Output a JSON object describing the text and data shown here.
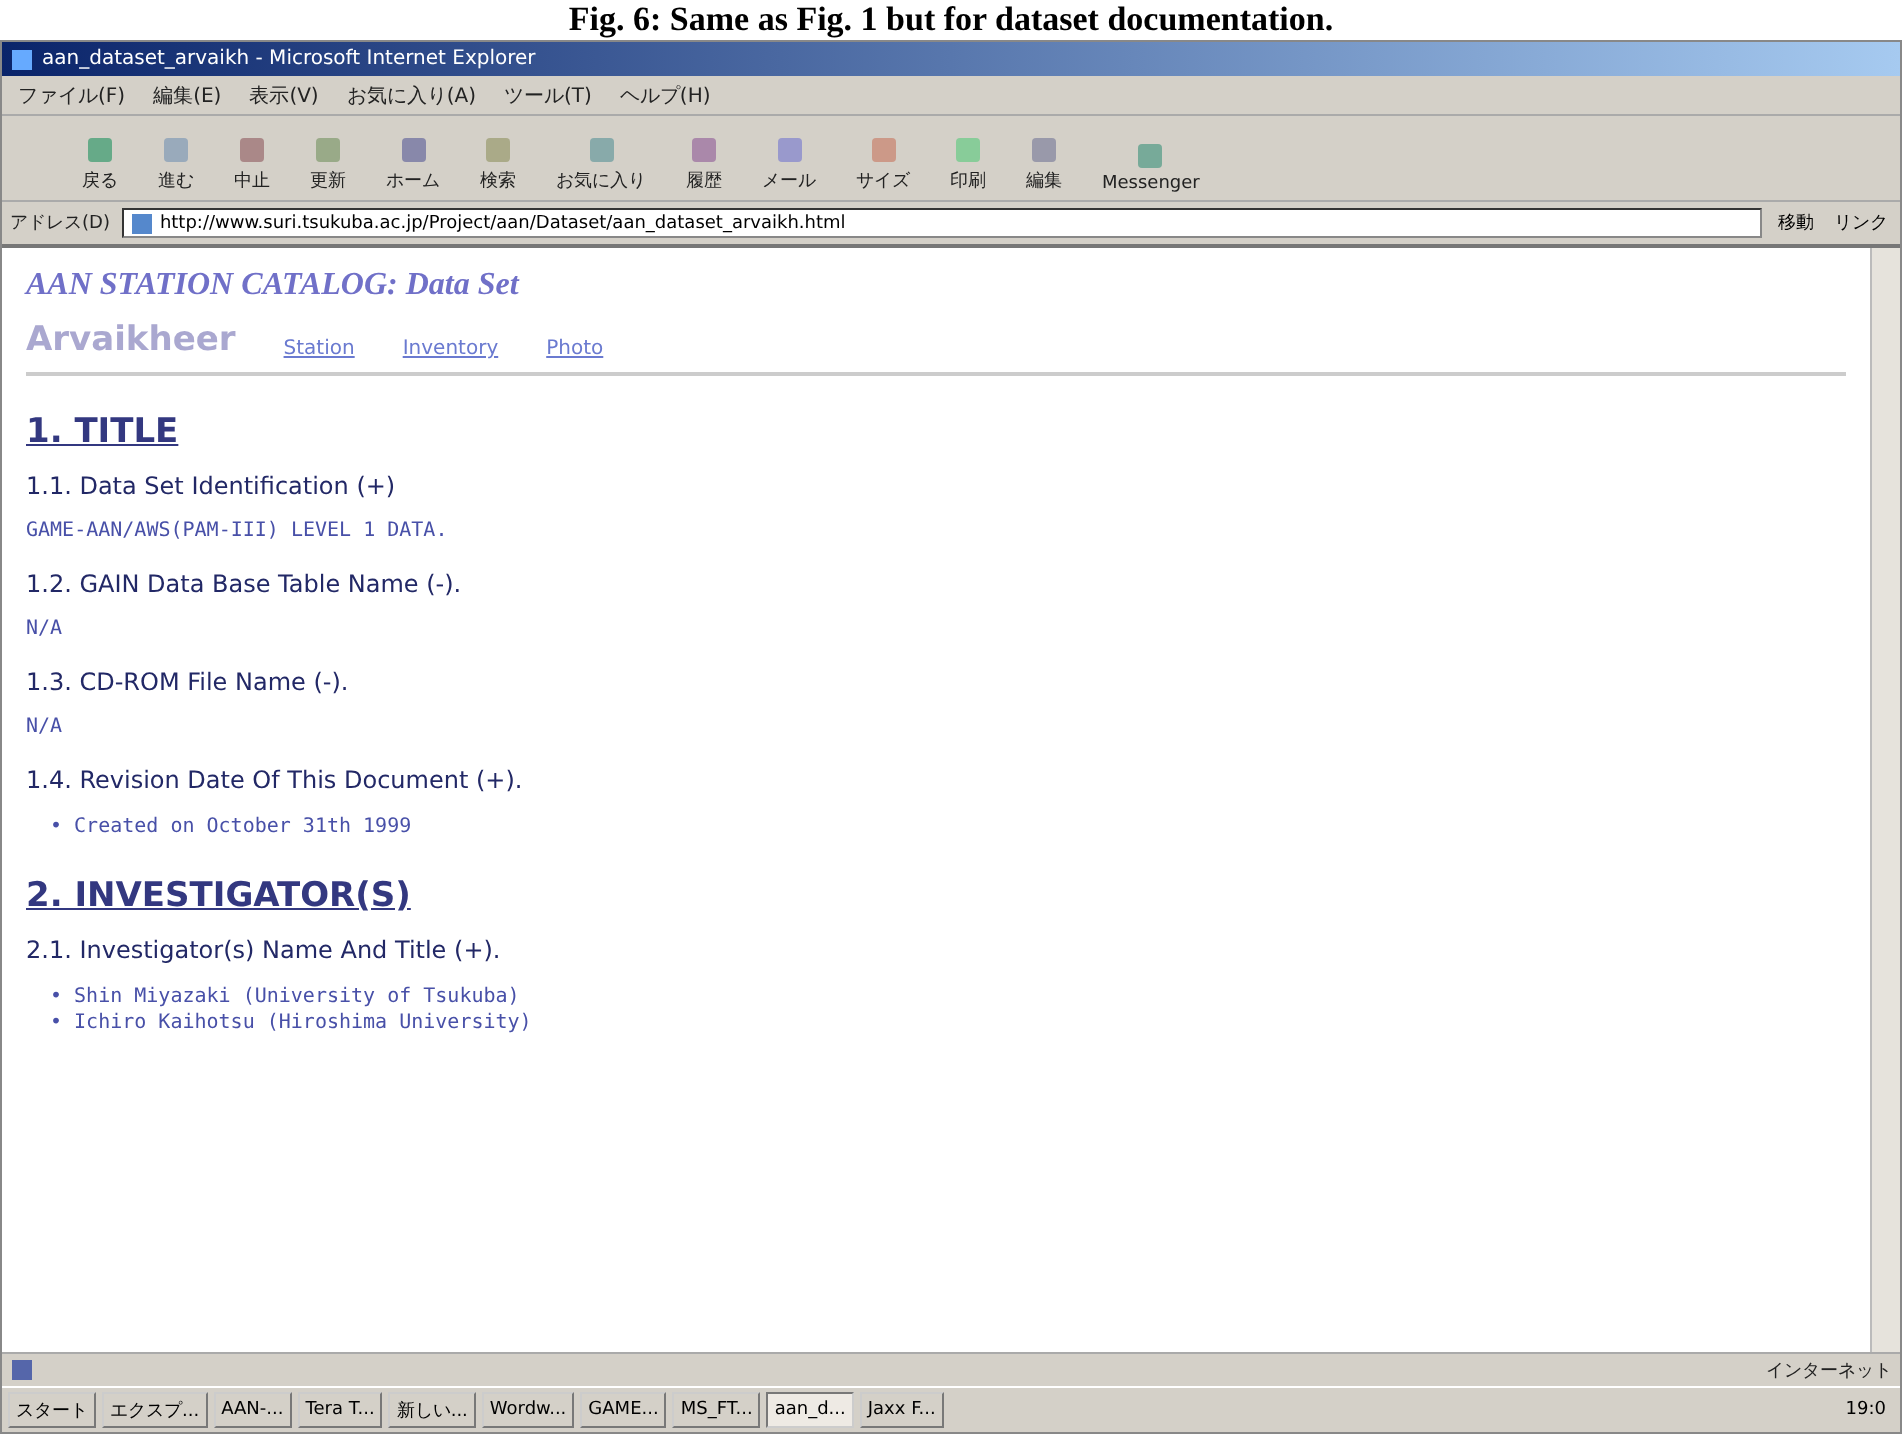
{
  "caption": "Fig. 6: Same as Fig. 1 but for dataset documentation.",
  "window": {
    "title": "aan_dataset_arvaikh - Microsoft Internet Explorer"
  },
  "menu": [
    "ファイル(F)",
    "編集(E)",
    "表示(V)",
    "お気に入り(A)",
    "ツール(T)",
    "ヘルプ(H)"
  ],
  "toolbar": [
    {
      "label": "戻る"
    },
    {
      "label": "進む"
    },
    {
      "label": "中止"
    },
    {
      "label": "更新"
    },
    {
      "label": "ホーム"
    },
    {
      "label": "検索"
    },
    {
      "label": "お気に入り"
    },
    {
      "label": "履歴"
    },
    {
      "label": "メール"
    },
    {
      "label": "サイズ"
    },
    {
      "label": "印刷"
    },
    {
      "label": "編集"
    },
    {
      "label": "Messenger"
    }
  ],
  "address": {
    "label": "アドレス(D)",
    "value": "http://www.suri.tsukuba.ac.jp/Project/aan/Dataset/aan_dataset_arvaikh.html",
    "go": "移動",
    "links": "リンク"
  },
  "page": {
    "heading": "AAN STATION CATALOG: Data Set",
    "station": "Arvaikheer",
    "nav": [
      "Station",
      "Inventory",
      "Photo"
    ],
    "sections": [
      {
        "title": "1. TITLE",
        "items": [
          {
            "title": "1.1. Data Set Identification (+)",
            "kind": "text",
            "lines": [
              "GAME-AAN/AWS(PAM-III) LEVEL 1 DATA."
            ]
          },
          {
            "title": "1.2. GAIN Data Base Table Name (-).",
            "kind": "text",
            "lines": [
              "N/A"
            ]
          },
          {
            "title": "1.3. CD-ROM File Name (-).",
            "kind": "text",
            "lines": [
              "N/A"
            ]
          },
          {
            "title": "1.4. Revision Date Of This Document (+).",
            "kind": "list",
            "marker": "•",
            "lines": [
              "Created on October 31th 1999"
            ]
          }
        ]
      },
      {
        "title": "2. INVESTIGATOR(S)",
        "items": [
          {
            "title": "2.1. Investigator(s) Name And Title (+).",
            "kind": "list",
            "marker": "•",
            "lines": [
              "Shin Miyazaki (University of Tsukuba)",
              "Ichiro Kaihotsu (Hiroshima University)"
            ]
          }
        ]
      }
    ]
  },
  "status_bar": {
    "zone": "インターネット"
  },
  "taskbar": {
    "start": "スタート",
    "tasks": [
      {
        "label": "エクスプ...",
        "selected": false
      },
      {
        "label": "AAN-...",
        "selected": false
      },
      {
        "label": "Tera T...",
        "selected": false
      },
      {
        "label": "新しい...",
        "selected": false
      },
      {
        "label": "Wordw...",
        "selected": false
      },
      {
        "label": "GAME...",
        "selected": false
      },
      {
        "label": "MS_FT...",
        "selected": false
      },
      {
        "label": "aan_d...",
        "selected": true
      },
      {
        "label": "Jaxx F...",
        "selected": false
      }
    ],
    "clock": "19:0"
  }
}
